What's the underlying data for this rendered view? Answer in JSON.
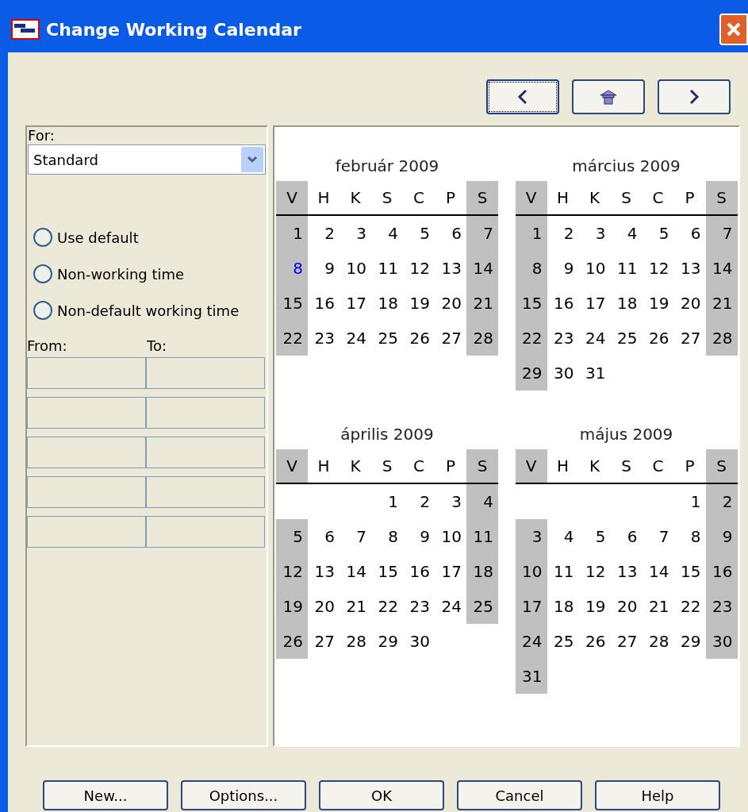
{
  "window": {
    "title": "Change Working Calendar"
  },
  "nav_buttons": [
    {
      "kind": "prev",
      "focused": true
    },
    {
      "kind": "home",
      "focused": false
    },
    {
      "kind": "next",
      "focused": false
    }
  ],
  "for": {
    "label": "For:",
    "value": "Standard"
  },
  "options": [
    {
      "label": "Use default",
      "selected": false
    },
    {
      "label": "Non-working time",
      "selected": false
    },
    {
      "label": "Non-default working time",
      "selected": false
    }
  ],
  "time_columns": [
    "From:",
    "To:"
  ],
  "months": [
    {
      "title": "február 2009",
      "weekdays": [
        {
          "label": "V",
          "weekend": true
        },
        {
          "label": "H",
          "weekend": false
        },
        {
          "label": "K",
          "weekend": false
        },
        {
          "label": "S",
          "weekend": false
        },
        {
          "label": "C",
          "weekend": false
        },
        {
          "label": "P",
          "weekend": false
        },
        {
          "label": "S",
          "weekend": true
        }
      ],
      "weeks": [
        {
          "days": [
            "1",
            "2",
            "3",
            "4",
            "5",
            "6",
            "7"
          ],
          "starts_midweek": false
        },
        {
          "days": [
            {
              "text": "8",
              "today": true
            },
            "9",
            "10",
            "11",
            "12",
            "13",
            "14"
          ],
          "starts_midweek": false
        },
        {
          "days": [
            "15",
            "16",
            "17",
            "18",
            "19",
            "20",
            "21"
          ],
          "starts_midweek": false
        },
        {
          "days": [
            "22",
            "23",
            "24",
            "25",
            "26",
            "27",
            "28"
          ],
          "starts_midweek": false
        }
      ]
    },
    {
      "title": "március 2009",
      "weekdays": [
        {
          "label": "V",
          "weekend": true
        },
        {
          "label": "H",
          "weekend": false
        },
        {
          "label": "K",
          "weekend": false
        },
        {
          "label": "S",
          "weekend": false
        },
        {
          "label": "C",
          "weekend": false
        },
        {
          "label": "P",
          "weekend": false
        },
        {
          "label": "S",
          "weekend": true
        }
      ],
      "weeks": [
        {
          "days": [
            "1",
            "2",
            "3",
            "4",
            "5",
            "6",
            "7"
          ],
          "starts_midweek": false
        },
        {
          "days": [
            "8",
            "9",
            "10",
            "11",
            "12",
            "13",
            "14"
          ],
          "starts_midweek": false
        },
        {
          "days": [
            "15",
            "16",
            "17",
            "18",
            "19",
            "20",
            "21"
          ],
          "starts_midweek": false
        },
        {
          "days": [
            "22",
            "23",
            "24",
            "25",
            "26",
            "27",
            "28"
          ],
          "starts_midweek": false
        },
        {
          "days": [
            "29",
            "30",
            "31"
          ],
          "starts_midweek": false
        }
      ]
    },
    {
      "title": "április 2009",
      "weekdays": [
        {
          "label": "V",
          "weekend": true
        },
        {
          "label": "H",
          "weekend": false
        },
        {
          "label": "K",
          "weekend": false
        },
        {
          "label": "S",
          "weekend": false
        },
        {
          "label": "C",
          "weekend": false
        },
        {
          "label": "P",
          "weekend": false
        },
        {
          "label": "S",
          "weekend": true
        }
      ],
      "weeks": [
        {
          "days": [
            "1",
            "2",
            "3",
            "4"
          ],
          "starts_midweek": true
        },
        {
          "days": [
            "5",
            "6",
            "7",
            "8",
            "9",
            "10",
            "11"
          ],
          "starts_midweek": false
        },
        {
          "days": [
            "12",
            "13",
            "14",
            "15",
            "16",
            "17",
            "18"
          ],
          "starts_midweek": false
        },
        {
          "days": [
            "19",
            "20",
            "21",
            "22",
            "23",
            "24",
            "25"
          ],
          "starts_midweek": false
        },
        {
          "days": [
            "26",
            "27",
            "28",
            "29",
            "30"
          ],
          "starts_midweek": false
        }
      ]
    },
    {
      "title": "május 2009",
      "weekdays": [
        {
          "label": "V",
          "weekend": true
        },
        {
          "label": "H",
          "weekend": false
        },
        {
          "label": "K",
          "weekend": false
        },
        {
          "label": "S",
          "weekend": false
        },
        {
          "label": "C",
          "weekend": false
        },
        {
          "label": "P",
          "weekend": false
        },
        {
          "label": "S",
          "weekend": true
        }
      ],
      "weeks": [
        {
          "days": [
            "1",
            "2"
          ],
          "starts_midweek": true
        },
        {
          "days": [
            "3",
            "4",
            "5",
            "6",
            "7",
            "8",
            "9"
          ],
          "starts_midweek": false
        },
        {
          "days": [
            "10",
            "11",
            "12",
            "13",
            "14",
            "15",
            "16"
          ],
          "starts_midweek": false
        },
        {
          "days": [
            "17",
            "18",
            "19",
            "20",
            "21",
            "22",
            "23"
          ],
          "starts_midweek": false
        },
        {
          "days": [
            "24",
            "25",
            "26",
            "27",
            "28",
            "29",
            "30"
          ],
          "starts_midweek": false
        },
        {
          "days": [
            "31"
          ],
          "starts_midweek": false
        }
      ]
    }
  ],
  "buttons": [
    "New...",
    "Options...",
    "OK",
    "Cancel",
    "Help"
  ]
}
